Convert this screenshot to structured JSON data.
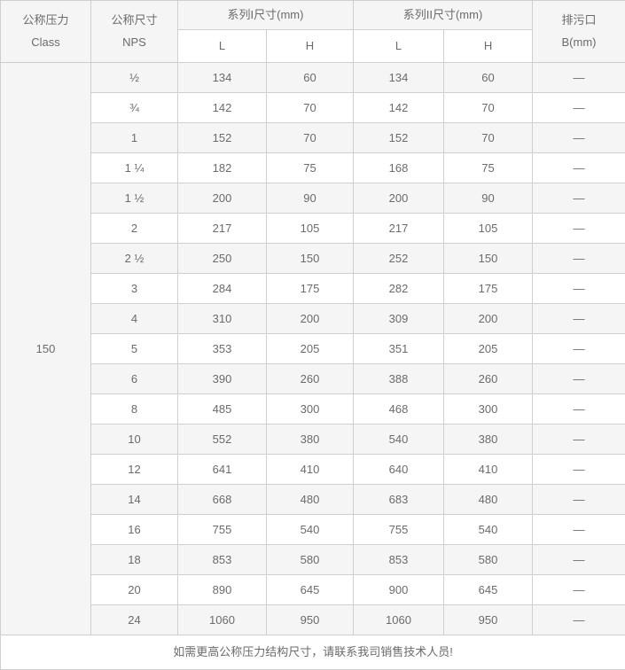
{
  "table": {
    "header": {
      "class_col": {
        "cn": "公称压力",
        "en": "Class"
      },
      "nps_col": {
        "cn": "公称尺寸",
        "en": "NPS"
      },
      "series1_group": "系列I尺寸(mm)",
      "series2_group": "系列II尺寸(mm)",
      "blowdown_col": {
        "cn": "排污口",
        "en": "B(mm)"
      },
      "sub": {
        "s1_l": "L",
        "s1_h": "H",
        "s2_l": "L",
        "s2_h": "H"
      }
    },
    "class_value": "150",
    "columns": [
      "NPS",
      "L",
      "H",
      "L",
      "H",
      "B(mm)"
    ],
    "rows": [
      {
        "nps": "½",
        "s1_l": "134",
        "s1_h": "60",
        "s2_l": "134",
        "s2_h": "60",
        "b": "—"
      },
      {
        "nps": "¾",
        "s1_l": "142",
        "s1_h": "70",
        "s2_l": "142",
        "s2_h": "70",
        "b": "—"
      },
      {
        "nps": "1",
        "s1_l": "152",
        "s1_h": "70",
        "s2_l": "152",
        "s2_h": "70",
        "b": "—"
      },
      {
        "nps": "1 ¼",
        "s1_l": "182",
        "s1_h": "75",
        "s2_l": "168",
        "s2_h": "75",
        "b": "—"
      },
      {
        "nps": "1 ½",
        "s1_l": "200",
        "s1_h": "90",
        "s2_l": "200",
        "s2_h": "90",
        "b": "—"
      },
      {
        "nps": "2",
        "s1_l": "217",
        "s1_h": "105",
        "s2_l": "217",
        "s2_h": "105",
        "b": "—"
      },
      {
        "nps": "2 ½",
        "s1_l": "250",
        "s1_h": "150",
        "s2_l": "252",
        "s2_h": "150",
        "b": "—"
      },
      {
        "nps": "3",
        "s1_l": "284",
        "s1_h": "175",
        "s2_l": "282",
        "s2_h": "175",
        "b": "—"
      },
      {
        "nps": "4",
        "s1_l": "310",
        "s1_h": "200",
        "s2_l": "309",
        "s2_h": "200",
        "b": "—"
      },
      {
        "nps": "5",
        "s1_l": "353",
        "s1_h": "205",
        "s2_l": "351",
        "s2_h": "205",
        "b": "—"
      },
      {
        "nps": "6",
        "s1_l": "390",
        "s1_h": "260",
        "s2_l": "388",
        "s2_h": "260",
        "b": "—"
      },
      {
        "nps": "8",
        "s1_l": "485",
        "s1_h": "300",
        "s2_l": "468",
        "s2_h": "300",
        "b": "—"
      },
      {
        "nps": "10",
        "s1_l": "552",
        "s1_h": "380",
        "s2_l": "540",
        "s2_h": "380",
        "b": "—"
      },
      {
        "nps": "12",
        "s1_l": "641",
        "s1_h": "410",
        "s2_l": "640",
        "s2_h": "410",
        "b": "—"
      },
      {
        "nps": "14",
        "s1_l": "668",
        "s1_h": "480",
        "s2_l": "683",
        "s2_h": "480",
        "b": "—"
      },
      {
        "nps": "16",
        "s1_l": "755",
        "s1_h": "540",
        "s2_l": "755",
        "s2_h": "540",
        "b": "—"
      },
      {
        "nps": "18",
        "s1_l": "853",
        "s1_h": "580",
        "s2_l": "853",
        "s2_h": "580",
        "b": "—"
      },
      {
        "nps": "20",
        "s1_l": "890",
        "s1_h": "645",
        "s2_l": "900",
        "s2_h": "645",
        "b": "—"
      },
      {
        "nps": "24",
        "s1_l": "1060",
        "s1_h": "950",
        "s2_l": "1060",
        "s2_h": "950",
        "b": "—"
      }
    ],
    "footer_note": "如需更高公称压力结构尺寸，请联系我司销售技术人员!"
  },
  "colors": {
    "border": "#cfcfcf",
    "header_bg": "#f5f5f5",
    "stripe_bg": "#f5f5f5",
    "text": "#6b6b6b",
    "page_bg": "#ffffff"
  }
}
